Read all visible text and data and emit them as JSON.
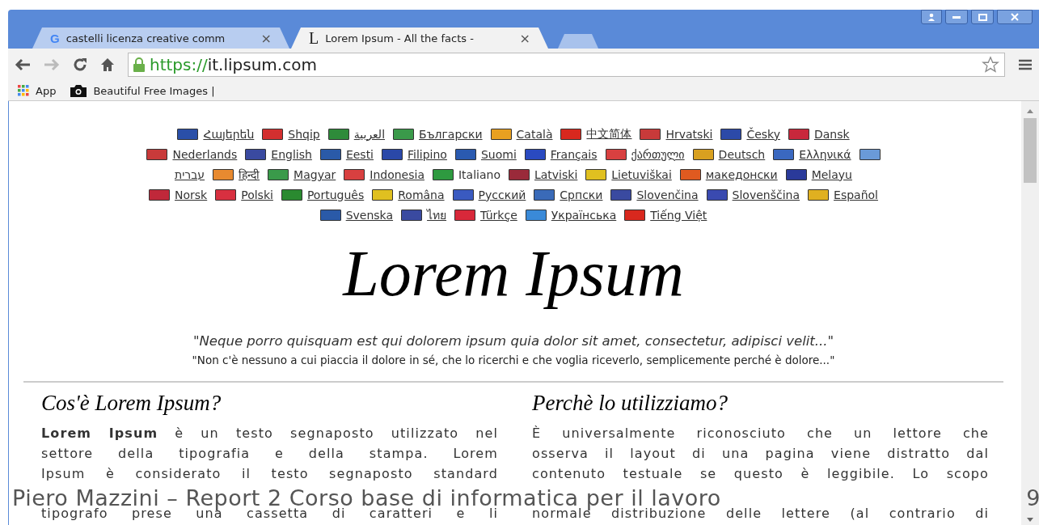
{
  "tabs": [
    {
      "title": "castelli licenza creative comm",
      "close": "×",
      "icon": "G",
      "selected": false
    },
    {
      "title": "Lorem Ipsum - All the facts -",
      "close": "×",
      "icon": "L",
      "selected": true
    }
  ],
  "address": {
    "scheme": "https://",
    "host": "it.lipsum.com"
  },
  "bookmarks": [
    {
      "label": "App",
      "kind": "apps"
    },
    {
      "label": "Beautiful Free Images |",
      "kind": "camera"
    }
  ],
  "languages": [
    [
      {
        "label": "Հայերեն",
        "color": "#2a4fa8",
        "selected": false
      },
      {
        "label": "Shqip",
        "color": "#d32f2f",
        "selected": false
      },
      {
        "label": "العربية",
        "color": "#2e8b3a",
        "selected": false
      },
      {
        "label": "Български",
        "color": "#3a9a4a",
        "selected": false
      },
      {
        "label": "Català",
        "color": "#e8a020",
        "selected": false
      },
      {
        "label": "中文简体",
        "color": "#d8281e",
        "selected": false
      },
      {
        "label": "Hrvatski",
        "color": "#c83a3a",
        "selected": false
      },
      {
        "label": "Česky",
        "color": "#2c4aa8",
        "selected": false
      },
      {
        "label": "Dansk",
        "color": "#c8283c",
        "selected": false
      }
    ],
    [
      {
        "label": "Nederlands",
        "color": "#c83a3a",
        "selected": false
      },
      {
        "label": "English",
        "color": "#3a4aa0",
        "selected": false
      },
      {
        "label": "Eesti",
        "color": "#2a5aa8",
        "selected": false
      },
      {
        "label": "Filipino",
        "color": "#2a48a8",
        "selected": false
      },
      {
        "label": "Suomi",
        "color": "#2a5ab0",
        "selected": false
      },
      {
        "label": "Français",
        "color": "#2a4ac0",
        "selected": false
      },
      {
        "label": "ქართული",
        "color": "#d84040",
        "selected": false
      },
      {
        "label": "Deutsch",
        "color": "#d8a020",
        "selected": false
      },
      {
        "label": "Ελληνικά",
        "color": "#3a68c0",
        "selected": false
      },
      {
        "kind": "flag",
        "color": "#6a9ad8"
      }
    ],
    [
      {
        "kind": "text",
        "label": "עברית",
        "selected": false
      },
      {
        "label": "हिन्दी",
        "color": "#e88a30",
        "selected": false
      },
      {
        "label": "Magyar",
        "color": "#3a9a4a",
        "selected": false
      },
      {
        "label": "Indonesia",
        "color": "#d84040",
        "selected": false
      },
      {
        "label": "Italiano",
        "color": "#2e9a40",
        "selected": true
      },
      {
        "label": "Latviski",
        "color": "#9a2a3a",
        "selected": false
      },
      {
        "label": "Lietuviškai",
        "color": "#e0c020",
        "selected": false
      },
      {
        "label": "македонски",
        "color": "#e05a20",
        "selected": false
      },
      {
        "label": "Melayu",
        "color": "#2a3a9a",
        "selected": false
      }
    ],
    [
      {
        "label": "Norsk",
        "color": "#c0283a",
        "selected": false
      },
      {
        "label": "Polski",
        "color": "#d83040",
        "selected": false
      },
      {
        "label": "Português",
        "color": "#2a8a30",
        "selected": false
      },
      {
        "label": "Româna",
        "color": "#e0c020",
        "selected": false
      },
      {
        "label": "Русский",
        "color": "#3a5ac0",
        "selected": false
      },
      {
        "label": "Српски",
        "color": "#3a6ab8",
        "selected": false
      },
      {
        "label": "Slovenčina",
        "color": "#3a4aa0",
        "selected": false
      },
      {
        "label": "Slovenščina",
        "color": "#3a4ab0",
        "selected": false
      },
      {
        "label": "Español",
        "color": "#e0b020",
        "selected": false
      }
    ],
    [
      {
        "label": "Svenska",
        "color": "#2a5aa8",
        "selected": false
      },
      {
        "label": "ไทย",
        "color": "#3a4aa0",
        "selected": false
      },
      {
        "label": "Türkçe",
        "color": "#d8283a",
        "selected": false
      },
      {
        "label": "Українська",
        "color": "#3a8ad8",
        "selected": false
      },
      {
        "label": "Tiếng Việt",
        "color": "#d8281e",
        "selected": false
      }
    ]
  ],
  "title": "Lorem Ipsum",
  "quote": "\"Neque porro quisquam est qui dolorem ipsum quia dolor sit amet, consectetur, adipisci velit...\"",
  "quote_translation": "\"Non c'è nessuno a cui piaccia il dolore in sé, che lo ricerchi e che voglia riceverlo, semplicemente perché è dolore...\"",
  "sections": [
    {
      "heading": "Cos'è Lorem Ipsum?",
      "lines": [
        "**Lorem Ipsum** è un testo segnaposto utilizzato nel",
        "settore della tipografia e della stampa. Lorem",
        "Ipsum è considerato il testo segnaposto standard"
      ],
      "lines_below": [
        "tipografo prese una cassetta di caratteri e li"
      ]
    },
    {
      "heading": "Perchè lo utilizziamo?",
      "lines": [
        "È universalmente riconosciuto che un lettore che",
        "osserva il layout di una pagina viene distratto dal",
        "contenuto testuale se questo è leggibile. Lo scopo"
      ],
      "lines_below": [
        "normale distribuzione delle lettere (al contrario di"
      ]
    }
  ],
  "footer": {
    "text": "Piero Mazzini – Report 2 Corso base di informatica per il lavoro",
    "page": "9"
  }
}
